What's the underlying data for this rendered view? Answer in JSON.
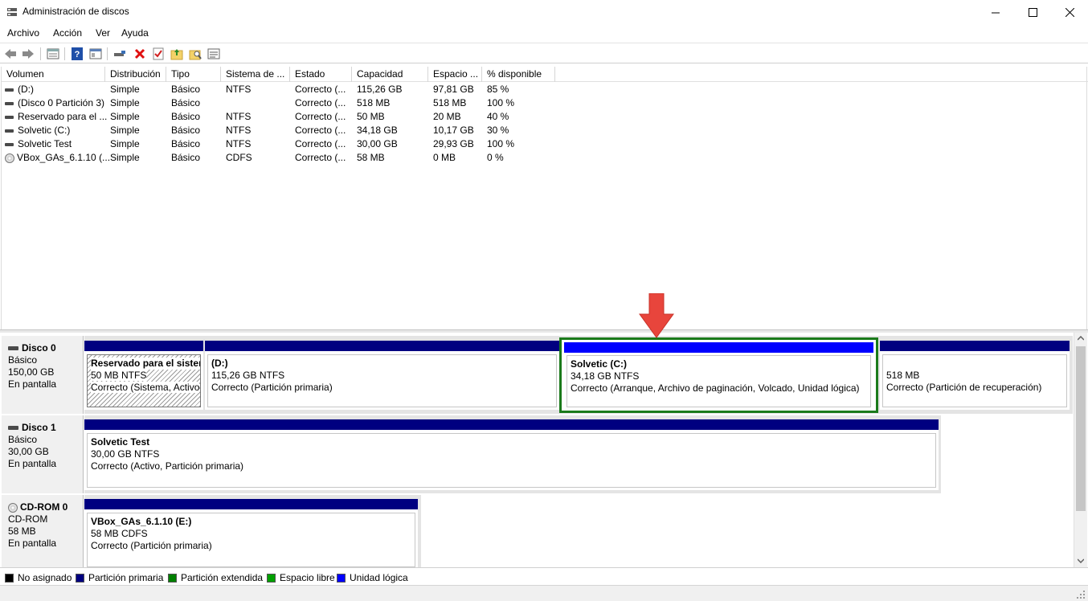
{
  "window": {
    "title": "Administración de discos"
  },
  "menu": [
    "Archivo",
    "Acción",
    "Ver",
    "Ayuda"
  ],
  "toolbar": {
    "icons": [
      "back-icon",
      "forward-icon",
      "properties-icon",
      "help-icon",
      "view-icon",
      "connect-icon",
      "delete-icon",
      "check-icon",
      "folder-up-icon",
      "search-folder-icon",
      "list-icon"
    ]
  },
  "columns": [
    "Volumen",
    "Distribución",
    "Tipo",
    "Sistema de ...",
    "Estado",
    "Capacidad",
    "Espacio ...",
    "% disponible"
  ],
  "volumes": [
    {
      "name": "(D:)",
      "layout": "Simple",
      "type": "Básico",
      "fs": "NTFS",
      "status": "Correcto (...",
      "capacity": "115,26 GB",
      "free": "97,81 GB",
      "pct": "85 %",
      "icon": "disk"
    },
    {
      "name": "(Disco 0 Partición 3)",
      "layout": "Simple",
      "type": "Básico",
      "fs": "",
      "status": "Correcto (...",
      "capacity": "518 MB",
      "free": "518 MB",
      "pct": "100 %",
      "icon": "disk"
    },
    {
      "name": "Reservado para el ...",
      "layout": "Simple",
      "type": "Básico",
      "fs": "NTFS",
      "status": "Correcto (...",
      "capacity": "50 MB",
      "free": "20 MB",
      "pct": "40 %",
      "icon": "disk"
    },
    {
      "name": "Solvetic (C:)",
      "layout": "Simple",
      "type": "Básico",
      "fs": "NTFS",
      "status": "Correcto (...",
      "capacity": "34,18 GB",
      "free": "10,17 GB",
      "pct": "30 %",
      "icon": "disk"
    },
    {
      "name": "Solvetic Test",
      "layout": "Simple",
      "type": "Básico",
      "fs": "NTFS",
      "status": "Correcto (...",
      "capacity": "30,00 GB",
      "free": "29,93 GB",
      "pct": "100 %",
      "icon": "disk"
    },
    {
      "name": "VBox_GAs_6.1.10 (...",
      "layout": "Simple",
      "type": "Básico",
      "fs": "CDFS",
      "status": "Correcto (...",
      "capacity": "58 MB",
      "free": "0 MB",
      "pct": "0 %",
      "icon": "cd"
    }
  ],
  "disks": {
    "disk0": {
      "name": "Disco 0",
      "type": "Básico",
      "size": "150,00 GB",
      "state": "En pantalla",
      "parts": {
        "reserved": {
          "name": "Reservado para el sisten",
          "size": "50 MB NTFS",
          "status": "Correcto (Sistema, Activo"
        },
        "d": {
          "name": "(D:)",
          "size": "115,26 GB NTFS",
          "status": "Correcto (Partición primaria)"
        },
        "c": {
          "name": "Solvetic  (C:)",
          "size": "34,18 GB NTFS",
          "status": "Correcto (Arranque, Archivo de paginación, Volcado, Unidad lógica)"
        },
        "recovery": {
          "name": "",
          "size": "518 MB",
          "status": "Correcto (Partición de recuperación)"
        }
      }
    },
    "disk1": {
      "name": "Disco 1",
      "type": "Básico",
      "size": "30,00 GB",
      "state": "En pantalla",
      "parts": {
        "test": {
          "name": "Solvetic Test",
          "size": "30,00 GB NTFS",
          "status": "Correcto (Activo, Partición primaria)"
        }
      }
    },
    "cdrom0": {
      "name": "CD-ROM 0",
      "type": "CD-ROM",
      "size": "58 MB",
      "state": "En pantalla",
      "parts": {
        "vbox": {
          "name": "VBox_GAs_6.1.10  (E:)",
          "size": "58 MB CDFS",
          "status": "Correcto (Partición primaria)"
        }
      }
    }
  },
  "legend": [
    {
      "label": "No asignado",
      "color": "#000000"
    },
    {
      "label": "Partición primaria",
      "color": "#000080"
    },
    {
      "label": "Partición extendida",
      "color": "#008000"
    },
    {
      "label": "Espacio libre",
      "color": "#00a000"
    },
    {
      "label": "Unidad lógica",
      "color": "#0000ff"
    }
  ],
  "colors": {
    "primary_bar": "#000080",
    "logical_bar": "#0000ff",
    "selection_border": "#1a7a1a",
    "annotation_arrow": "#e8453c"
  }
}
